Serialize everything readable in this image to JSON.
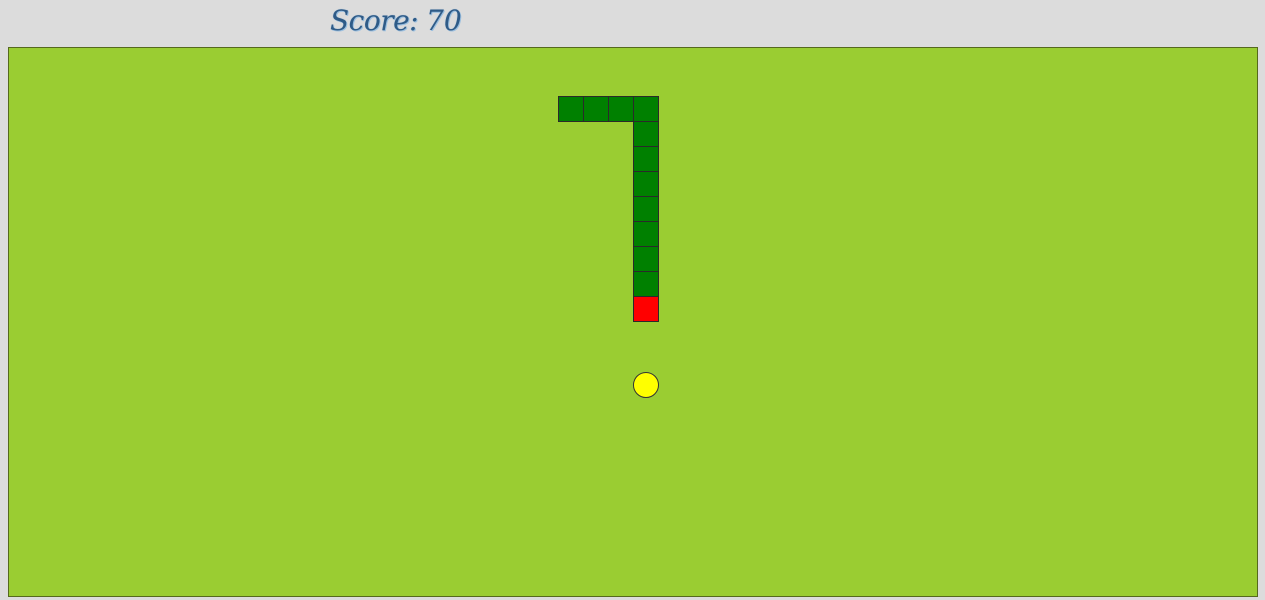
{
  "scorebar": {
    "label": "Score:",
    "value": "70"
  },
  "board": {
    "background_color": "#9acd32"
  },
  "snake": {
    "body_color": "#008000",
    "head_color": "#ff0000",
    "segment_count": 12
  },
  "food": {
    "color": "#ffff00"
  }
}
